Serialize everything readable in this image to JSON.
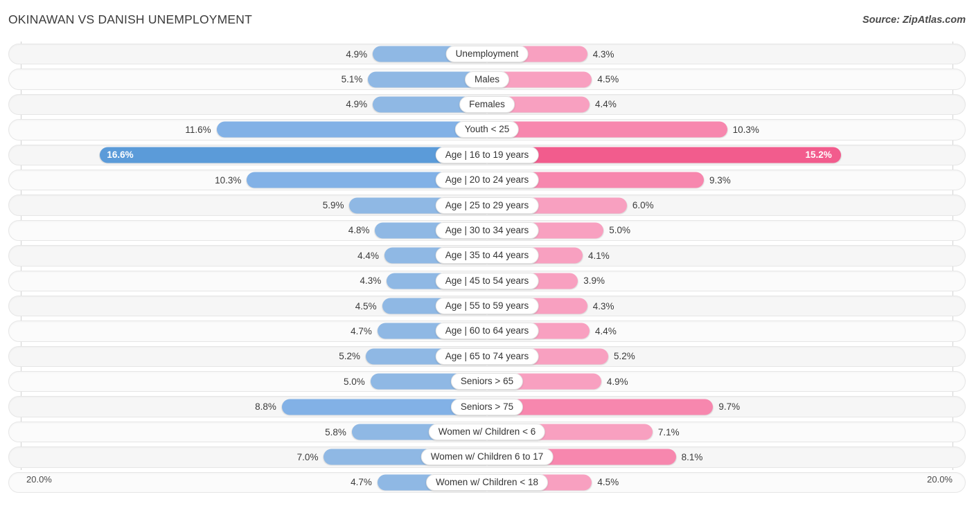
{
  "header": {
    "title": "OKINAWAN VS DANISH UNEMPLOYMENT",
    "source": "Source: ZipAtlas.com"
  },
  "axis": {
    "left_label": "20.0%",
    "right_label": "20.0%",
    "max": 20.0
  },
  "legend": {
    "items": [
      {
        "label": "Okinawan",
        "color": "#5b9bd9"
      },
      {
        "label": "Danish",
        "color": "#f25c8d"
      }
    ]
  },
  "colors": {
    "left_light": "#8fb8e4",
    "left_mid": "#82b1e6",
    "left_high": "#5b9bd9",
    "right_light": "#f8a0c0",
    "right_mid": "#f787ae",
    "right_high": "#f25c8d",
    "track": "#f6f6f6",
    "text": "#3a3a3a"
  },
  "chart_data": {
    "type": "bar",
    "title": "OKINAWAN VS DANISH UNEMPLOYMENT",
    "orientation": "horizontal-diverging",
    "xlabel": "",
    "ylabel": "",
    "xlim": [
      20.0,
      20.0
    ],
    "grid": false,
    "legend_position": "bottom-center",
    "categories": [
      "Unemployment",
      "Males",
      "Females",
      "Youth < 25",
      "Age | 16 to 19 years",
      "Age | 20 to 24 years",
      "Age | 25 to 29 years",
      "Age | 30 to 34 years",
      "Age | 35 to 44 years",
      "Age | 45 to 54 years",
      "Age | 55 to 59 years",
      "Age | 60 to 64 years",
      "Age | 65 to 74 years",
      "Seniors > 65",
      "Seniors > 75",
      "Women w/ Children < 6",
      "Women w/ Children 6 to 17",
      "Women w/ Children < 18"
    ],
    "series": [
      {
        "name": "Okinawan",
        "side": "left",
        "values": [
          4.9,
          5.1,
          4.9,
          11.6,
          16.6,
          10.3,
          5.9,
          4.8,
          4.4,
          4.3,
          4.5,
          4.7,
          5.2,
          5.0,
          8.8,
          5.8,
          7.0,
          4.7
        ],
        "labels": [
          "4.9%",
          "5.1%",
          "4.9%",
          "11.6%",
          "16.6%",
          "10.3%",
          "5.9%",
          "4.8%",
          "4.4%",
          "4.3%",
          "4.5%",
          "4.7%",
          "5.2%",
          "5.0%",
          "8.8%",
          "5.8%",
          "7.0%",
          "4.7%"
        ]
      },
      {
        "name": "Danish",
        "side": "right",
        "values": [
          4.3,
          4.5,
          4.4,
          10.3,
          15.2,
          9.3,
          6.0,
          5.0,
          4.1,
          3.9,
          4.3,
          4.4,
          5.2,
          4.9,
          9.7,
          7.1,
          8.1,
          4.5
        ],
        "labels": [
          "4.3%",
          "4.5%",
          "4.4%",
          "10.3%",
          "15.2%",
          "9.3%",
          "6.0%",
          "5.0%",
          "4.1%",
          "3.9%",
          "4.3%",
          "4.4%",
          "5.2%",
          "4.9%",
          "9.7%",
          "7.1%",
          "8.1%",
          "4.5%"
        ]
      }
    ]
  }
}
